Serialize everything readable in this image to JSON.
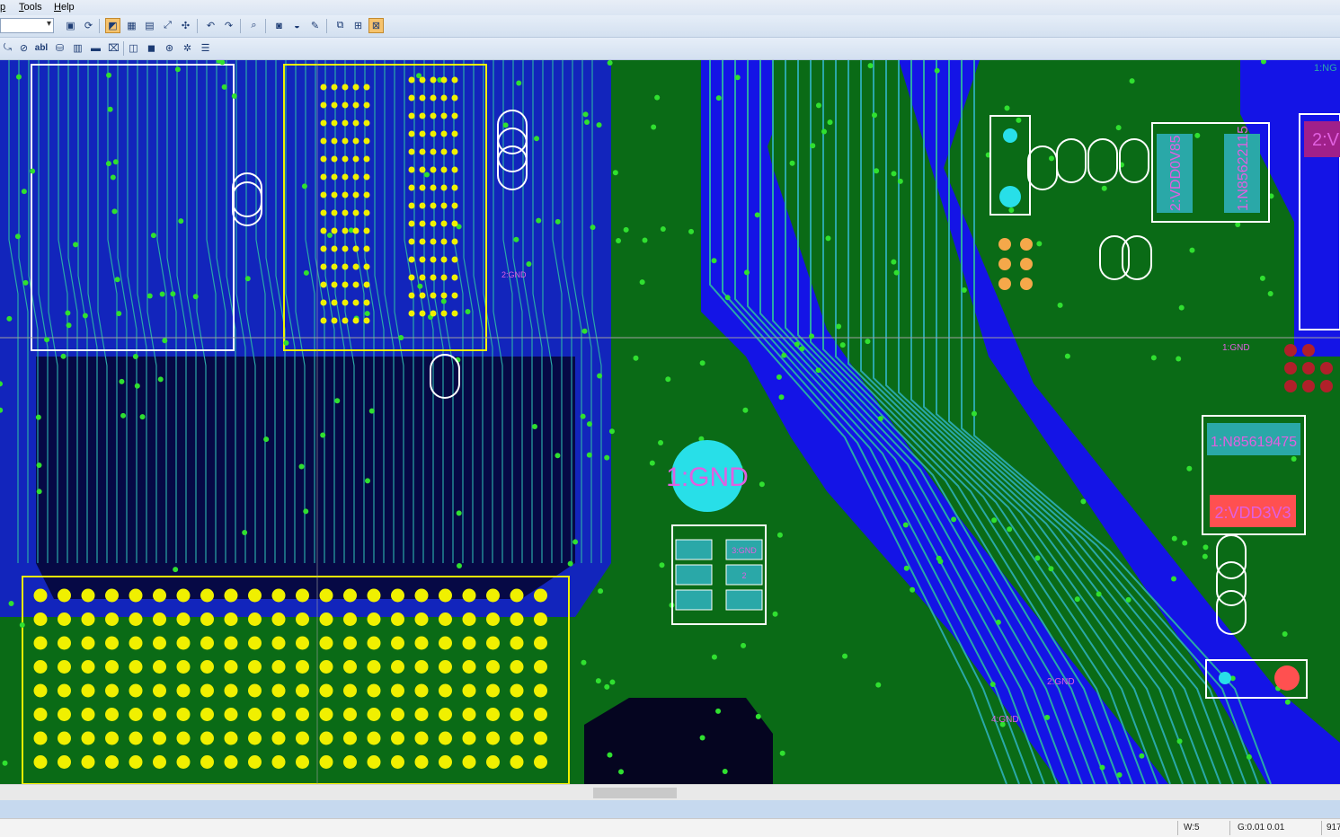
{
  "menu": {
    "items": [
      {
        "pre": "",
        "u": "p",
        "post": ""
      },
      {
        "pre": "",
        "u": "T",
        "post": "ools"
      },
      {
        "pre": "",
        "u": "H",
        "post": "elp"
      }
    ]
  },
  "toolbar": {
    "layer_value": ""
  },
  "board": {
    "labels": {
      "gnd_pad": "1:GND",
      "vdd_box_1": "2:VDD0V85",
      "vdd_box_2": "1:N85622115",
      "net_box_1": "1:N85619475",
      "net_box_2": "2:VDD3V3",
      "vdd_edge": "2:VD",
      "corner_tag": "1:NG",
      "vdd_small": "1\nVDD2",
      "gnd_a": "2:GND",
      "gnd_b": "1:GND",
      "gnd_c": "2:GND",
      "gnd_d": "3:GND",
      "gnd_e": "2",
      "gnd_f": "2:GND",
      "gnd_g": "4:GND",
      "gnd_h": "2:GND",
      "gnd_i": "1:GND",
      "gnd_j": "2:GND"
    },
    "colors": {
      "board": "#0a6b16",
      "plane": "#1414e6",
      "trace": "#2aa8a8",
      "via": "#30e030",
      "bga": "#f0f000",
      "outline": "#ffffff",
      "highlight_pad": "#28dfe8",
      "red_pad": "#ff5050"
    }
  },
  "status": {
    "width": "W:5",
    "grid": "G:0.01 0.01",
    "coord": "917"
  }
}
